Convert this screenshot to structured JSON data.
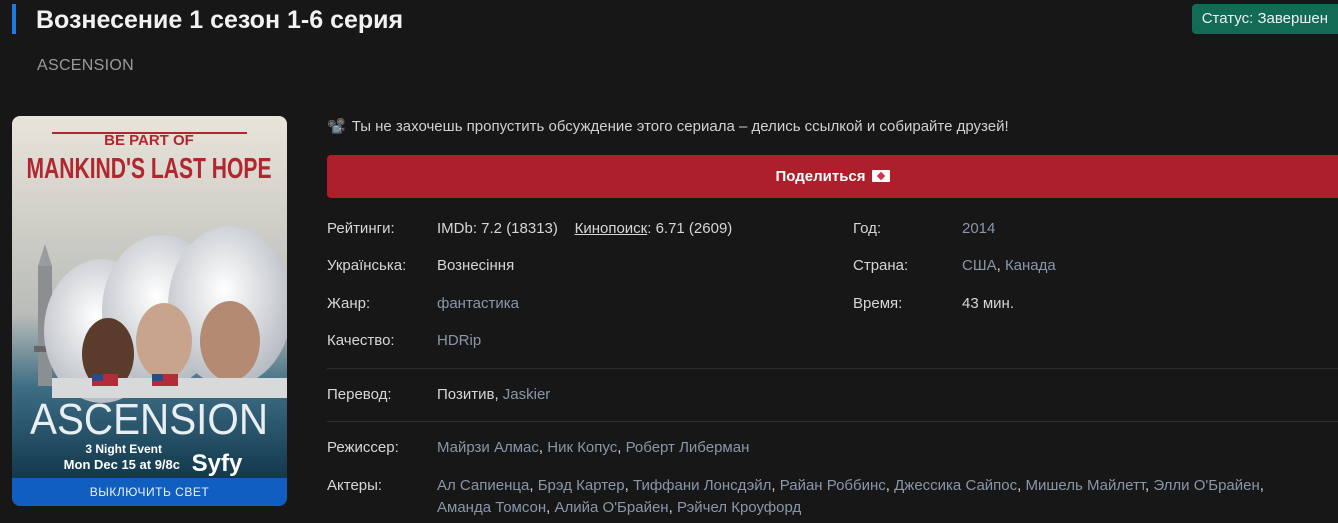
{
  "header": {
    "title": "Вознесение 1 сезон 1-6 серия",
    "original_title": "ASCENSION",
    "status": "Статус: Завершен"
  },
  "poster": {
    "tagline_top": "BE PART OF",
    "tagline_main": "MANKIND'S LAST HOPE",
    "show_name": "ASCENSION",
    "event_line1": "3 Night Event",
    "event_line2": "Mon Dec 15 at 9/8c",
    "network": "Syfy",
    "lights_button": "ВЫКЛЮЧИТЬ СВЕТ"
  },
  "share": {
    "note": "Ты не захочешь пропустить обсуждение этого сериала – делись ссылкой и собирайте друзей!",
    "button": "Поделиться"
  },
  "info": {
    "ratings_label": "Рейтинги:",
    "imdb": "IMDb: 7.2 (18313)",
    "kp_label": "Кинопоиск",
    "kp_value": ": 6.71 (2609)",
    "ukr_label": "Українська:",
    "ukr_value": "Вознесіння",
    "genre_label": "Жанр:",
    "genre_value": "фантастика",
    "quality_label": "Качество:",
    "quality_value": "HDRip",
    "year_label": "Год:",
    "year_value": "2014",
    "country_label": "Страна:",
    "country_1": "США",
    "country_2": "Канада",
    "time_label": "Время:",
    "time_value": "43 мин.",
    "translation_label": "Перевод:",
    "translation_1": "Позитив",
    "translation_2": "Jaskier",
    "director_label": "Режиссер:",
    "directors": [
      "Майрзи Алмас",
      "Ник Копус",
      "Роберт Либерман"
    ],
    "actors_label": "Актеры:",
    "actors_line1": [
      "Ал Сапиенца",
      "Брэд Картер",
      "Тиффани Лонсдэйл",
      "Райан Роббинс",
      "Джессика Сайпос",
      "Мишель Майлетт",
      "Элли О'Брайен"
    ],
    "actors_line2": [
      "Аманда Томсон",
      "Алийа О'Брайен",
      "Рэйчел Кроуфорд"
    ]
  }
}
